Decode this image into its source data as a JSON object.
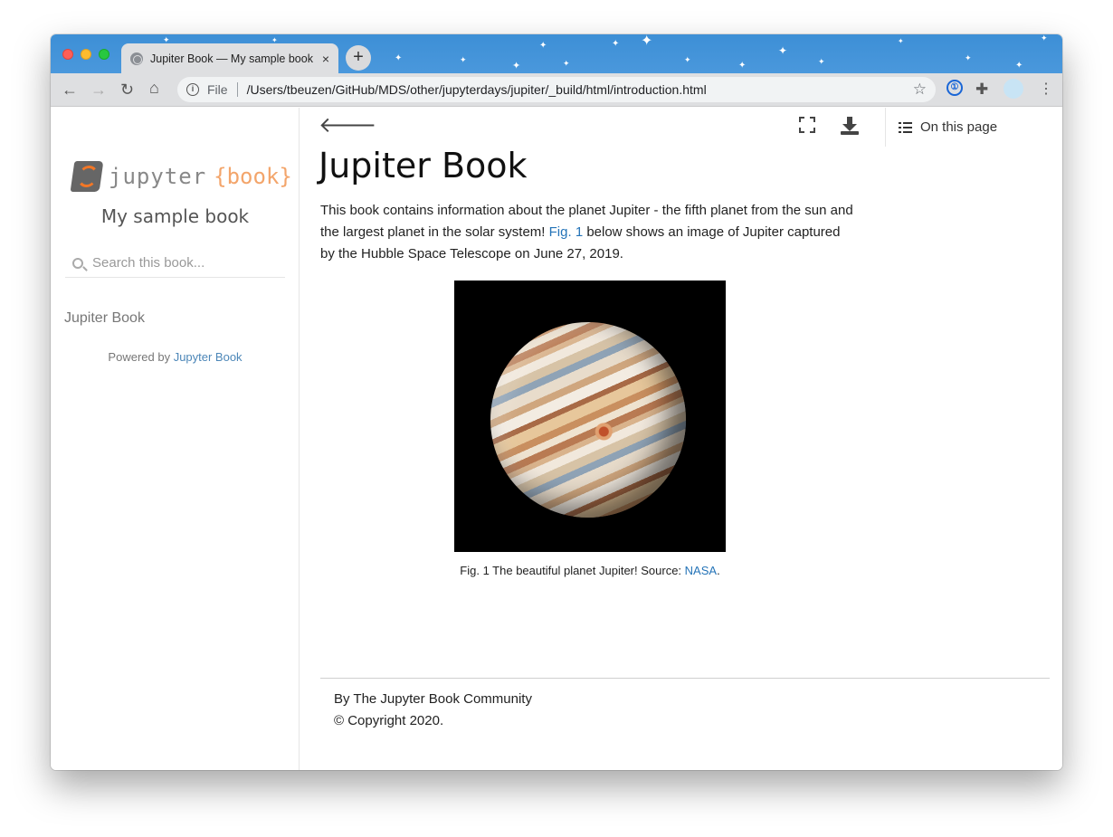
{
  "browser": {
    "tab_title": "Jupiter Book — My sample book",
    "tab_close": "×",
    "new_tab": "+",
    "url_scheme": "File",
    "url": "/Users/tbeuzen/GitHub/MDS/other/jupyterdays/jupiter/_build/html/introduction.html",
    "icons": [
      "back-icon",
      "forward-icon",
      "reload-icon",
      "home-icon",
      "info-icon",
      "star-icon",
      "password-manager-icon",
      "extensions-icon",
      "profile-icon",
      "menu-icon"
    ]
  },
  "sidebar": {
    "logo_word": "jupyter",
    "logo_book": "{book}",
    "site_title": "My sample book",
    "search_placeholder": "Search this book...",
    "nav_items": [
      {
        "label": "Jupiter Book"
      }
    ],
    "powered_prefix": "Powered by ",
    "powered_link": "Jupyter Book"
  },
  "topbar": {
    "on_this_page": "On this page"
  },
  "content": {
    "title": "Jupiter Book",
    "para_1": "This book contains information about the planet Jupiter - the fifth planet from the sun and the largest planet in the solar system! ",
    "para_link": "Fig. 1",
    "para_2": " below shows an image of Jupiter captured by the Hubble Space Telescope on June 27, 2019.",
    "caption_prefix": "Fig. 1 The beautiful planet Jupiter! Source: ",
    "caption_link": "NASA",
    "caption_suffix": "."
  },
  "footer": {
    "line_1": "By The Jupyter Book Community",
    "line_2": "© Copyright 2020."
  },
  "colors": {
    "tabbar": "#4a98dc",
    "link": "#2574b8",
    "logo_accent": "#f37726"
  }
}
